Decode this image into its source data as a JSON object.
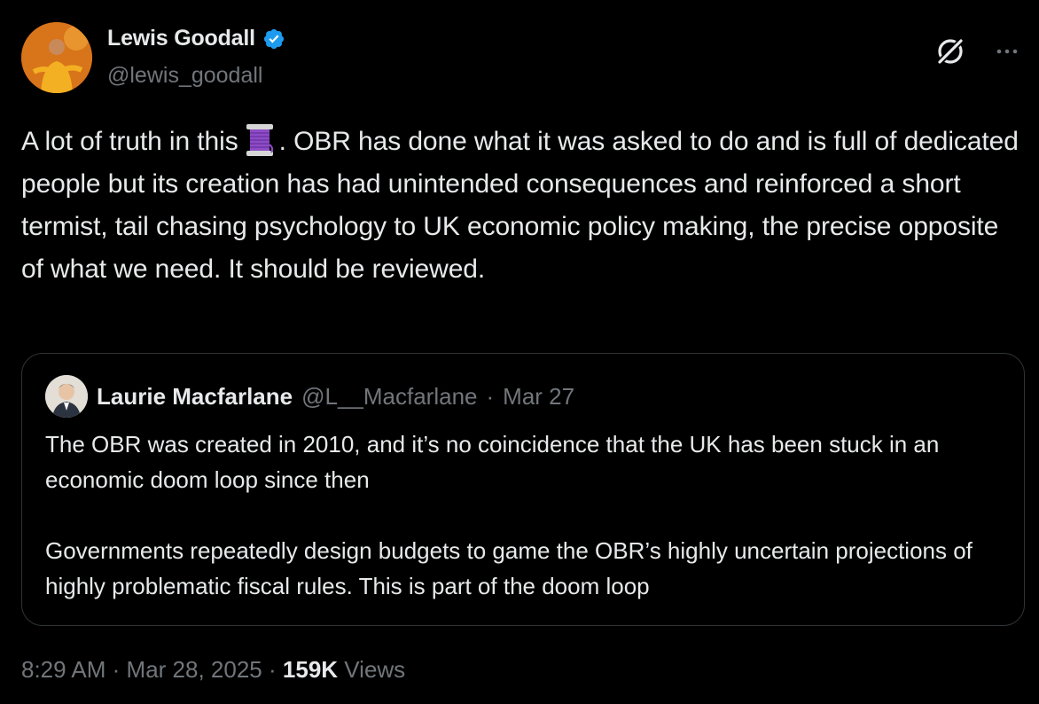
{
  "author": {
    "display_name": "Lewis Goodall",
    "handle": "@lewis_goodall",
    "verified": true
  },
  "tweet": {
    "text_before_emoji": "A lot of truth in this",
    "emoji": "thread-spool-icon",
    "text_after_emoji": ". OBR has done what it was asked to do and is full of dedicated people but its creation has had unintended consequences and reinforced a short termist, tail chasing psychology to UK economic policy making, the precise opposite of what we need. It should be reviewed."
  },
  "quote": {
    "display_name": "Laurie Macfarlane",
    "handle": "@L__Macfarlane",
    "separator": "·",
    "date": "Mar 27",
    "paragraphs": [
      "The OBR was created in 2010, and it’s no coincidence that the UK has been stuck in an economic doom loop since then",
      "Governments repeatedly design budgets to game the OBR’s highly uncertain projections of highly problematic fiscal rules. This is part of the doom loop"
    ]
  },
  "meta": {
    "time": "8:29 AM",
    "separator": "·",
    "date": "Mar 28, 2025",
    "views_count": "159K",
    "views_label": "Views"
  },
  "colors": {
    "background": "#000000",
    "text": "#e7e9ea",
    "secondary": "#71767b",
    "border": "#2f3336",
    "verified": "#1d9bf0"
  }
}
